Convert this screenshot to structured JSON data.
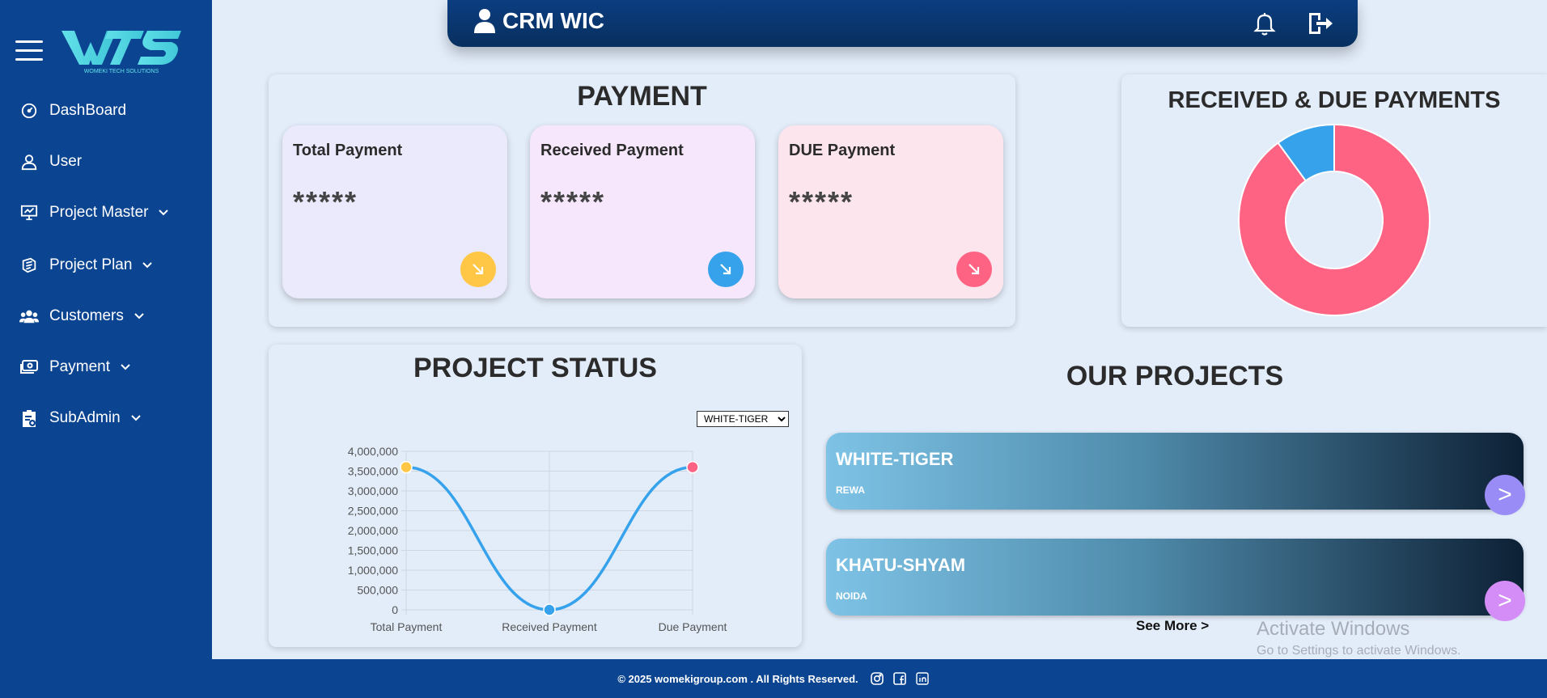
{
  "app": {
    "logo_text": "WTS",
    "logo_subtext": "WOMEKI TECH SOLUTIONS",
    "title": "CRM WIC"
  },
  "sidebar": {
    "items": [
      {
        "label": "DashBoard",
        "icon": "dashboard-gauge-icon",
        "has_dropdown": false
      },
      {
        "label": "User",
        "icon": "user-icon",
        "has_dropdown": false
      },
      {
        "label": "Project Master",
        "icon": "presentation-board-icon",
        "has_dropdown": true
      },
      {
        "label": "Project Plan",
        "icon": "layers-icon",
        "has_dropdown": true
      },
      {
        "label": "Customers",
        "icon": "users-group-icon",
        "has_dropdown": true
      },
      {
        "label": "Payment",
        "icon": "money-bill-icon",
        "has_dropdown": true
      },
      {
        "label": "SubAdmin",
        "icon": "clipboard-icon",
        "has_dropdown": true
      }
    ]
  },
  "payment": {
    "title": "PAYMENT",
    "cards": [
      {
        "label": "Total Payment",
        "value": "*****",
        "bg": "#ebeafd",
        "arrow_color": "#ffc745"
      },
      {
        "label": "Received Payment",
        "value": "*****",
        "bg": "#f6e7fd",
        "arrow_color": "#36a2eb"
      },
      {
        "label": "DUE Payment",
        "value": "*****",
        "bg": "#fde5ee",
        "arrow_color": "#ff6384"
      }
    ]
  },
  "received_due": {
    "title": "RECEIVED & DUE PAYMENTS"
  },
  "project_status": {
    "title": "PROJECT STATUS",
    "selected_project": "WHITE-TIGER"
  },
  "our_projects": {
    "title": "OUR PROJECTS",
    "projects": [
      {
        "name": "WHITE-TIGER",
        "location": "REWA",
        "button": ">",
        "button_color": "#9a8cf6"
      },
      {
        "name": "KHATU-SHYAM",
        "location": "NOIDA",
        "button": ">",
        "button_color": "#d48cf6"
      }
    ],
    "see_more": "See More >"
  },
  "watermark": {
    "line1": "Activate Windows",
    "line2": "Go to Settings to activate Windows."
  },
  "footer": {
    "text": "© 2025 womekigroup.com . All Rights Reserved."
  },
  "colors": {
    "sidebar": "#0b4592",
    "topbar": "#0b3d80",
    "background": "#e3edfa",
    "due": "#ff6384",
    "received": "#36a2eb",
    "total": "#ffc745"
  },
  "chart_data": [
    {
      "type": "pie",
      "variant": "doughnut",
      "title": "RECEIVED & DUE PAYMENTS",
      "labels": [
        "Due Payment",
        "Received Payment"
      ],
      "values": [
        90,
        10
      ],
      "colors": [
        "#ff6384",
        "#36a2eb"
      ],
      "legend": "none"
    },
    {
      "type": "line",
      "title": "PROJECT STATUS",
      "categories": [
        "Total Payment",
        "Received Payment",
        "Due Payment"
      ],
      "series": [
        {
          "values": [
            3600000,
            0,
            3600000
          ],
          "point_colors": [
            "#ffc745",
            "#36a2eb",
            "#ff6384"
          ],
          "line_color": "#36a2eb"
        }
      ],
      "ylim": [
        0,
        4000000
      ],
      "yticks": [
        "4,000,000",
        "3,500,000",
        "3,000,000",
        "2,500,000",
        "2,000,000",
        "1,500,000",
        "1,000,000",
        "500,000",
        "0"
      ],
      "grid": true,
      "legend": "none",
      "xlabel": "",
      "ylabel": ""
    }
  ]
}
